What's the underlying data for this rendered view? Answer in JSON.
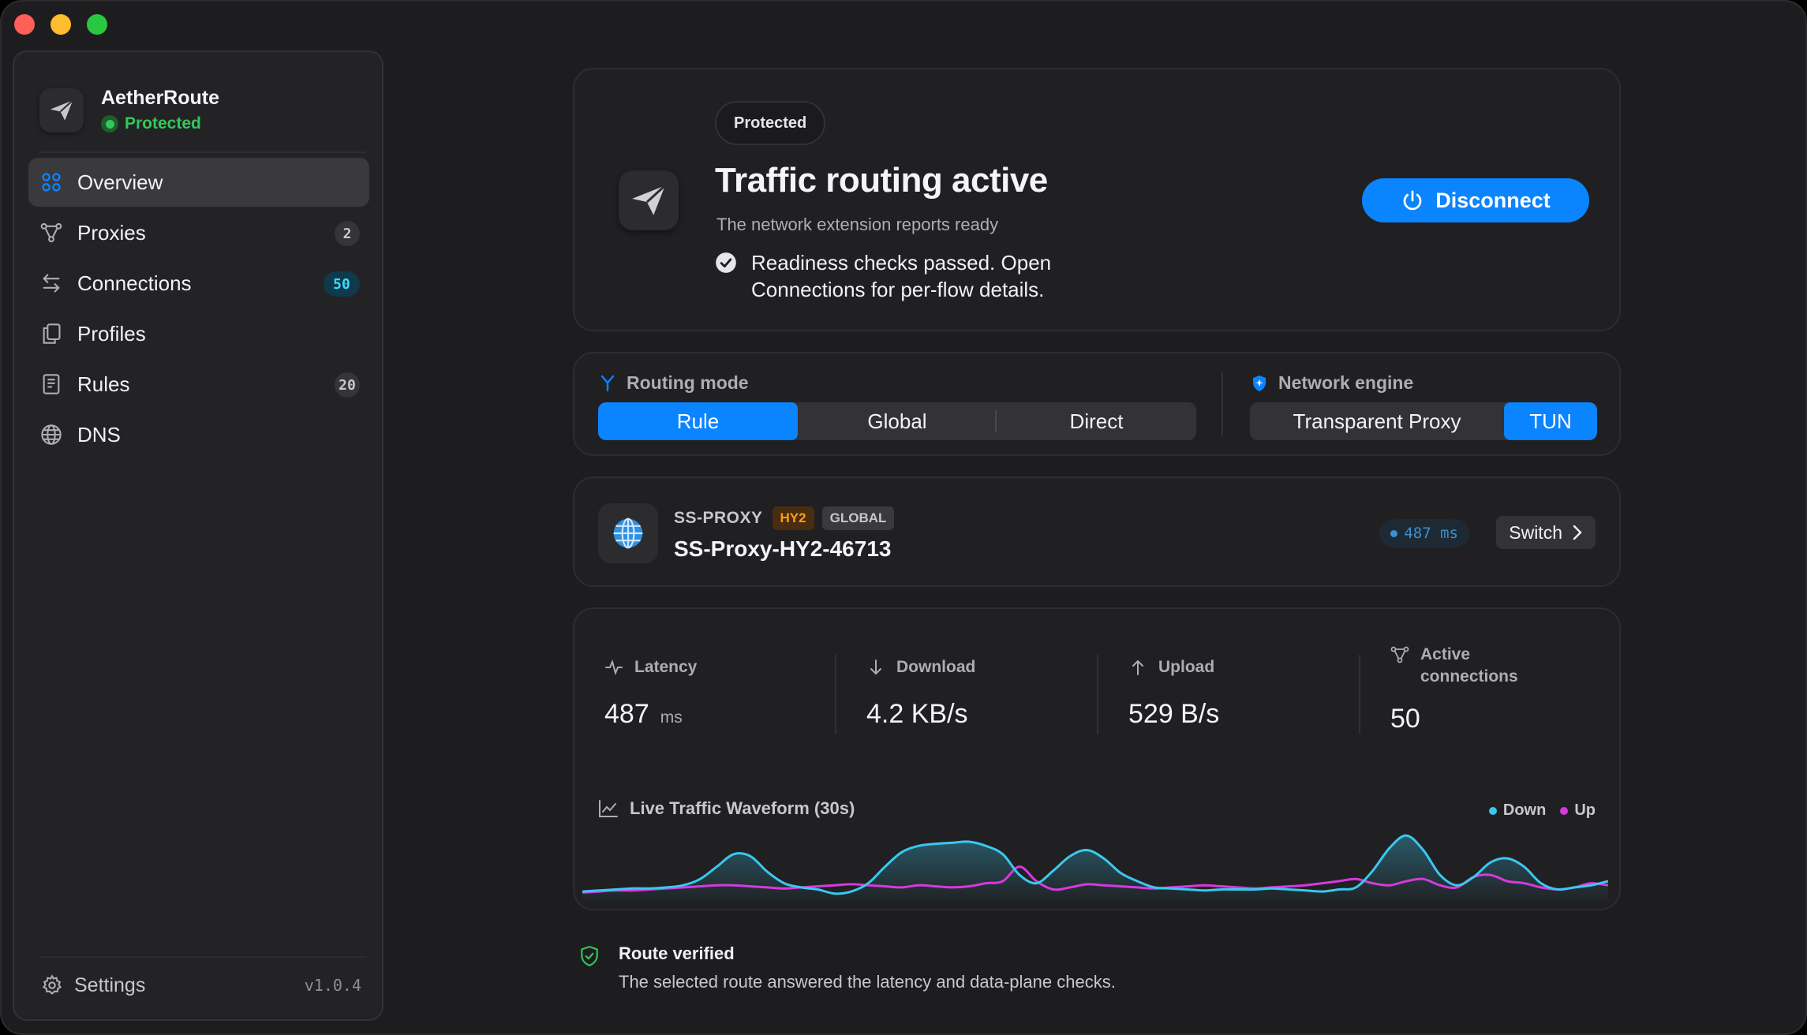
{
  "app": {
    "name": "AetherRoute",
    "status": "Protected",
    "version": "v1.0.4"
  },
  "sidebar": {
    "items": [
      {
        "label": "Overview",
        "icon": "grid-icon",
        "badge": null,
        "active": true
      },
      {
        "label": "Proxies",
        "icon": "proxies-icon",
        "badge": "2"
      },
      {
        "label": "Connections",
        "icon": "arrows-icon",
        "badge": "50"
      },
      {
        "label": "Profiles",
        "icon": "documents-icon",
        "badge": null
      },
      {
        "label": "Rules",
        "icon": "list-icon",
        "badge": "20"
      },
      {
        "label": "DNS",
        "icon": "globe-icon",
        "badge": null
      }
    ],
    "settings_label": "Settings"
  },
  "hero": {
    "pill": "Protected",
    "title": "Traffic routing active",
    "subtitle": "The network extension reports ready",
    "check_text": "Readiness checks passed. Open Connections for per-flow details.",
    "button_label": "Disconnect"
  },
  "routing": {
    "heading": "Routing mode",
    "options": [
      "Rule",
      "Global",
      "Direct"
    ],
    "selected": "Rule"
  },
  "engine": {
    "heading": "Network engine",
    "options": [
      "Transparent Proxy",
      "TUN"
    ],
    "selected": "TUN"
  },
  "proxy": {
    "group": "SS-PROXY",
    "tag_protocol": "HY2",
    "tag_scope": "GLOBAL",
    "name": "SS-Proxy-HY2-46713",
    "latency": "487 ms",
    "switch_label": "Switch"
  },
  "stats": {
    "latency": {
      "label": "Latency",
      "value": "487",
      "unit": "ms"
    },
    "download": {
      "label": "Download",
      "value": "4.2 KB/s"
    },
    "upload": {
      "label": "Upload",
      "value": "529 B/s"
    },
    "connections": {
      "label": "Active connections",
      "value": "50"
    }
  },
  "waveform": {
    "title": "Live Traffic Waveform (30s)",
    "legend": {
      "down": "Down",
      "up": "Up"
    },
    "colors": {
      "down": "#3ac8f0",
      "up": "#d63adb"
    },
    "down": [
      6,
      7,
      8,
      9,
      9,
      10,
      12,
      18,
      30,
      42,
      40,
      25,
      14,
      10,
      8,
      4,
      6,
      14,
      30,
      44,
      50,
      52,
      53,
      54,
      50,
      42,
      22,
      14,
      26,
      40,
      46,
      38,
      24,
      16,
      10,
      9,
      8,
      7,
      8,
      8,
      8,
      9,
      8,
      7,
      6,
      8,
      10,
      26,
      48,
      60,
      46,
      22,
      12,
      20,
      34,
      38,
      30,
      14,
      8,
      10,
      12,
      16
    ],
    "up": [
      5,
      6,
      7,
      7,
      8,
      9,
      10,
      11,
      12,
      12,
      11,
      10,
      9,
      10,
      11,
      12,
      13,
      12,
      11,
      10,
      12,
      11,
      10,
      11,
      14,
      16,
      30,
      16,
      8,
      10,
      13,
      12,
      11,
      10,
      9,
      10,
      11,
      12,
      11,
      10,
      9,
      10,
      11,
      12,
      14,
      16,
      18,
      14,
      12,
      16,
      18,
      12,
      10,
      20,
      22,
      16,
      14,
      10,
      8,
      10,
      14,
      12
    ]
  },
  "verified": {
    "title": "Route verified",
    "text": "The selected route answered the latency and data-plane checks."
  }
}
